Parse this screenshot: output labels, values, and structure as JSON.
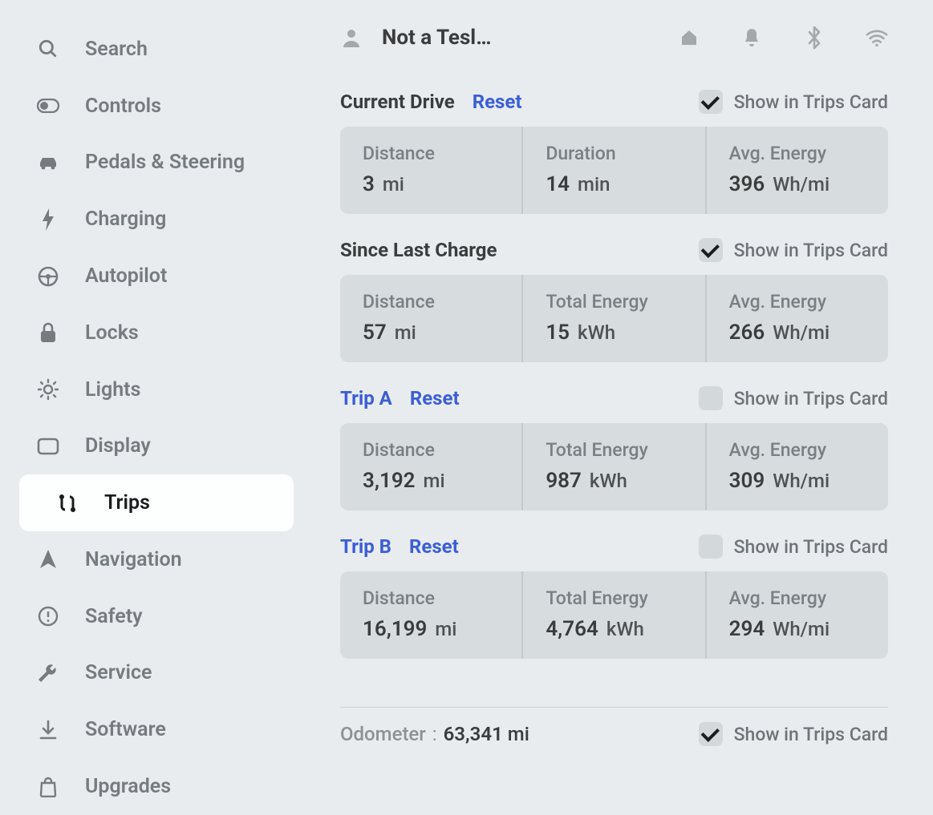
{
  "sidebar": {
    "items": [
      {
        "label": "Search"
      },
      {
        "label": "Controls"
      },
      {
        "label": "Pedals & Steering"
      },
      {
        "label": "Charging"
      },
      {
        "label": "Autopilot"
      },
      {
        "label": "Locks"
      },
      {
        "label": "Lights"
      },
      {
        "label": "Display"
      },
      {
        "label": "Trips"
      },
      {
        "label": "Navigation"
      },
      {
        "label": "Safety"
      },
      {
        "label": "Service"
      },
      {
        "label": "Software"
      },
      {
        "label": "Upgrades"
      }
    ],
    "active_index": 8
  },
  "header": {
    "profile_name": "Not a Tesl…"
  },
  "show_label": "Show in Trips Card",
  "reset_label": "Reset",
  "sections": [
    {
      "id": "current",
      "title": "Current Drive",
      "title_link": false,
      "has_reset": true,
      "checked": true,
      "cells": [
        {
          "label": "Distance",
          "value": "3",
          "unit": "mi"
        },
        {
          "label": "Duration",
          "value": "14",
          "unit": "min"
        },
        {
          "label": "Avg. Energy",
          "value": "396",
          "unit": "Wh/mi"
        }
      ]
    },
    {
      "id": "since_charge",
      "title": "Since Last Charge",
      "title_link": false,
      "has_reset": false,
      "checked": true,
      "cells": [
        {
          "label": "Distance",
          "value": "57",
          "unit": "mi"
        },
        {
          "label": "Total Energy",
          "value": "15",
          "unit": "kWh"
        },
        {
          "label": "Avg. Energy",
          "value": "266",
          "unit": "Wh/mi"
        }
      ]
    },
    {
      "id": "trip_a",
      "title": "Trip A",
      "title_link": true,
      "has_reset": true,
      "checked": false,
      "cells": [
        {
          "label": "Distance",
          "value": "3,192",
          "unit": "mi"
        },
        {
          "label": "Total Energy",
          "value": "987",
          "unit": "kWh"
        },
        {
          "label": "Avg. Energy",
          "value": "309",
          "unit": "Wh/mi"
        }
      ]
    },
    {
      "id": "trip_b",
      "title": "Trip B",
      "title_link": true,
      "has_reset": true,
      "checked": false,
      "cells": [
        {
          "label": "Distance",
          "value": "16,199",
          "unit": "mi"
        },
        {
          "label": "Total Energy",
          "value": "4,764",
          "unit": "kWh"
        },
        {
          "label": "Avg. Energy",
          "value": "294",
          "unit": "Wh/mi"
        }
      ]
    }
  ],
  "odometer": {
    "label": "Odometer",
    "separator": ":",
    "value": "63,341",
    "unit": "mi",
    "checked": true
  }
}
